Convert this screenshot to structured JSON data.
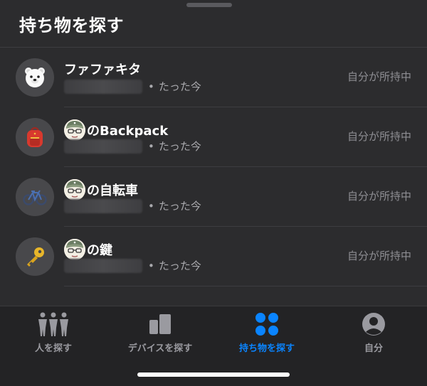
{
  "header": {
    "title": "持ち物を探す"
  },
  "items": [
    {
      "name_suffix": "ファファキタ",
      "has_memoji": false,
      "icon": "polar-bear-icon",
      "time": "たった今",
      "status": "自分が所持中"
    },
    {
      "name_suffix": "のBackpack",
      "has_memoji": true,
      "icon": "backpack-icon",
      "time": "たった今",
      "status": "自分が所持中"
    },
    {
      "name_suffix": "の自転車",
      "has_memoji": true,
      "icon": "bicycle-icon",
      "time": "たった今",
      "status": "自分が所持中"
    },
    {
      "name_suffix": "の鍵",
      "has_memoji": true,
      "icon": "key-icon",
      "time": "たった今",
      "status": "自分が所持中"
    }
  ],
  "separator": "•",
  "tabs": [
    {
      "label": "人を探す",
      "icon": "people-icon",
      "active": false
    },
    {
      "label": "デバイスを探す",
      "icon": "devices-icon",
      "active": false
    },
    {
      "label": "持ち物を探す",
      "icon": "items-grid-icon",
      "active": true
    },
    {
      "label": "自分",
      "icon": "person-circle-icon",
      "active": false
    }
  ],
  "colors": {
    "accent": "#0a84ff",
    "background": "#2c2c2e",
    "tab_inactive": "#9a9aa0"
  }
}
